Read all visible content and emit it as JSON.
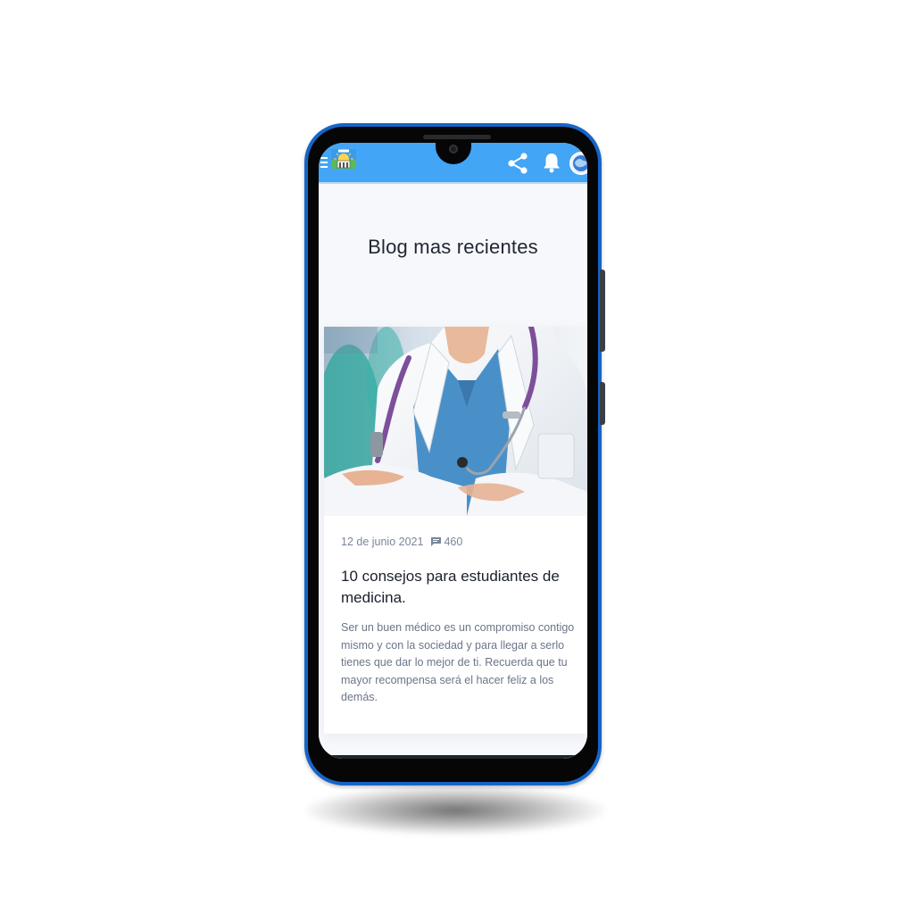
{
  "appbar": {
    "menu_icon": "hamburger-menu-icon",
    "logo": "university-logo",
    "share_icon": "share-icon",
    "notification_icon": "bell-icon",
    "avatar": "profile-avatar",
    "color": "#42a5f5"
  },
  "section": {
    "title": "Blog mas recientes"
  },
  "post": {
    "image": "doctor-stethoscope-photo",
    "date": "12 de junio 2021",
    "comment_icon": "comment-icon",
    "comments": "460",
    "title": "10 consejos para estudiantes de medicina.",
    "excerpt": "Ser un buen médico es un compromiso contigo mismo y con la sociedad y para llegar a serlo tienes que dar lo mejor de ti. Recuerda que tu mayor recompensa será el hacer feliz a los demás."
  },
  "colors": {
    "phone_frame": "#1565c8",
    "title_text": "#1f2633",
    "meta_text": "#7a8699",
    "excerpt_text": "#6b7589"
  }
}
